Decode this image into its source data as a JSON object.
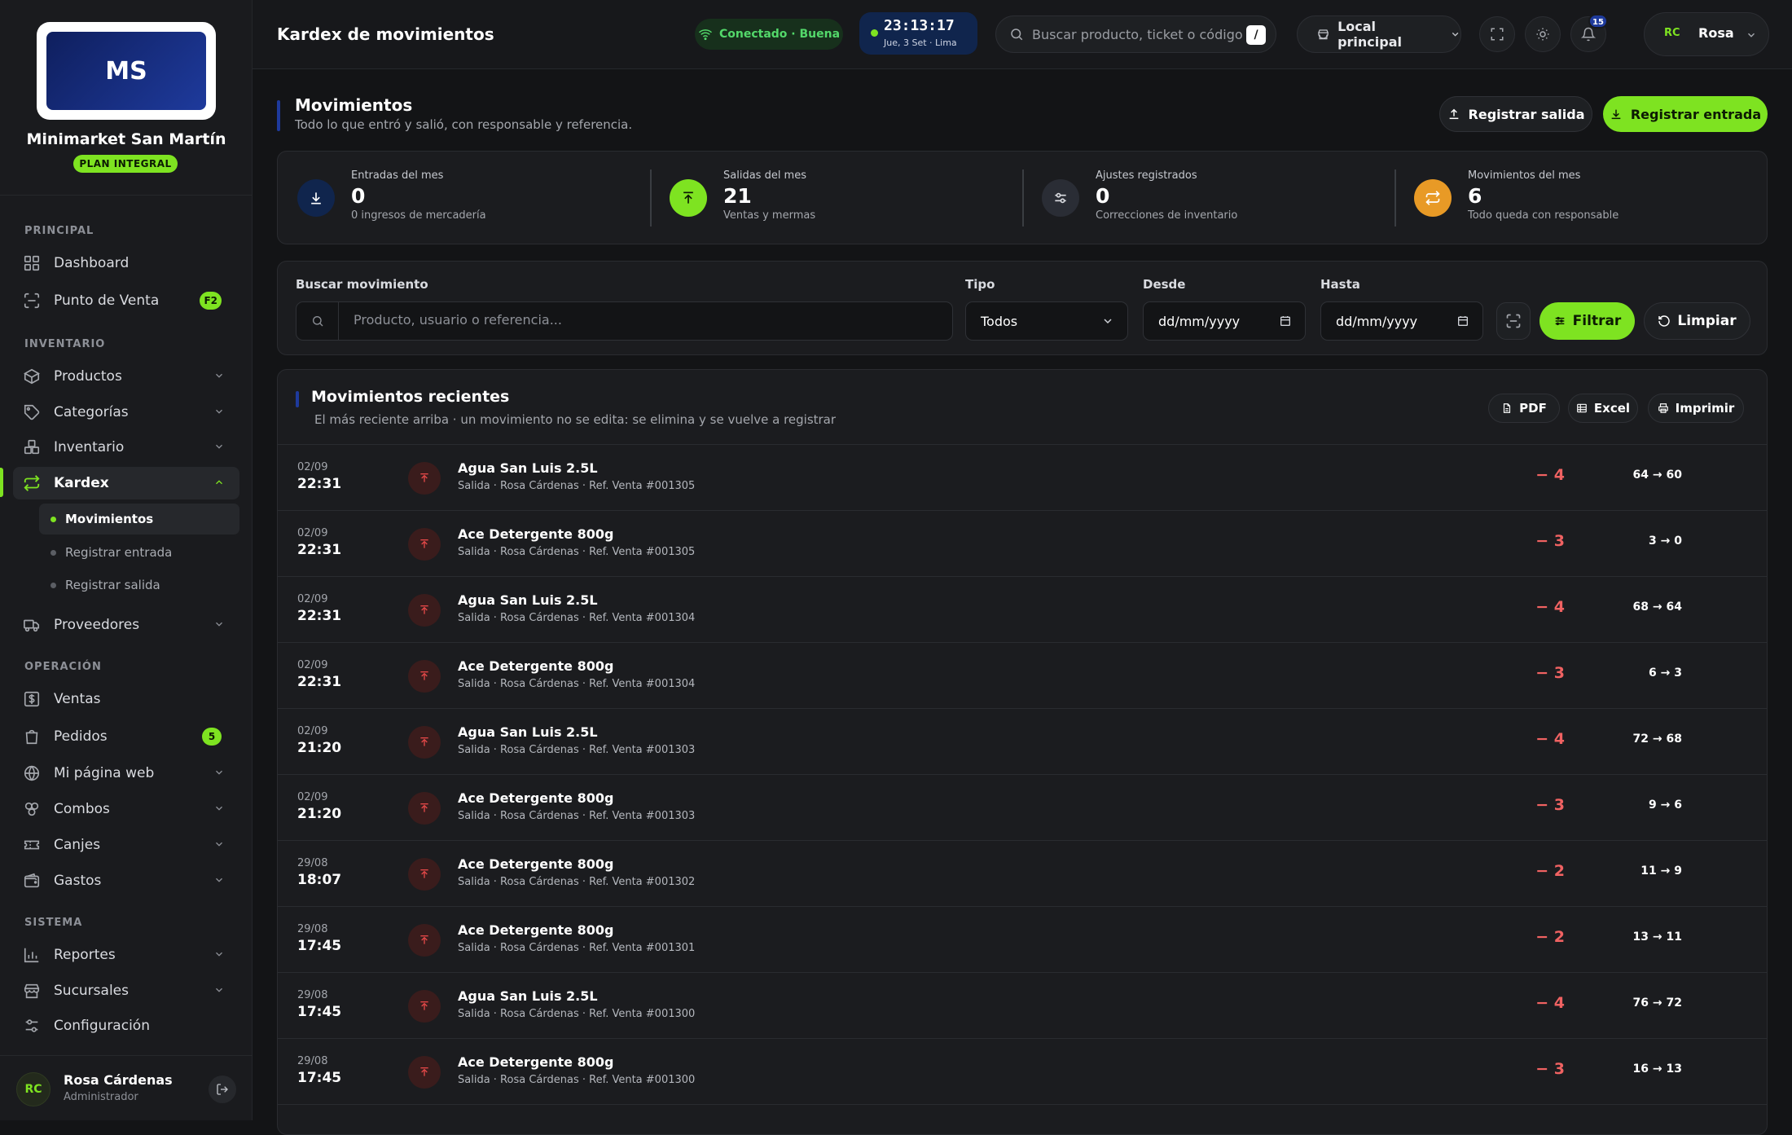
{
  "brand": {
    "logo_text": "MS",
    "name": "Minimarket San Martín",
    "plan": "PLAN INTEGRAL"
  },
  "sidebar": {
    "sections": [
      "PRINCIPAL",
      "INVENTARIO",
      "OPERACIÓN",
      "SISTEMA"
    ],
    "items": {
      "dashboard": "Dashboard",
      "pos": "Punto de Venta",
      "pos_badge": "F2",
      "productos": "Productos",
      "categorias": "Categorías",
      "inventario": "Inventario",
      "kardex": "Kardex",
      "movimientos": "Movimientos",
      "registrar_entrada": "Registrar entrada",
      "registrar_salida": "Registrar salida",
      "proveedores": "Proveedores",
      "ventas": "Ventas",
      "pedidos": "Pedidos",
      "pedidos_badge": "5",
      "web": "Mi página web",
      "combos": "Combos",
      "canjes": "Canjes",
      "gastos": "Gastos",
      "reportes": "Reportes",
      "sucursales": "Sucursales",
      "configuracion": "Configuración"
    },
    "user": {
      "initials": "RC",
      "name": "Rosa Cárdenas",
      "role": "Administrador"
    }
  },
  "topbar": {
    "title": "Kardex de movimientos",
    "connection": "Conectado · Buena",
    "time": "23:13:17",
    "date": "Jue, 3 Set · Lima",
    "search_placeholder": "Buscar producto, ticket o código...",
    "search_shortcut": "/",
    "location": "Local principal",
    "notifications": "15",
    "user_initials": "RC",
    "user_name": "Rosa"
  },
  "header": {
    "title": "Movimientos",
    "subtitle": "Todo lo que entró y salió, con responsable y referencia.",
    "btn_salida": "Registrar salida",
    "btn_entrada": "Registrar entrada"
  },
  "stats": [
    {
      "label": "Entradas del mes",
      "value": "0",
      "hint": "0 ingresos de mercadería"
    },
    {
      "label": "Salidas del mes",
      "value": "21",
      "hint": "Ventas y mermas"
    },
    {
      "label": "Ajustes registrados",
      "value": "0",
      "hint": "Correcciones de inventario"
    },
    {
      "label": "Movimientos del mes",
      "value": "6",
      "hint": "Todo queda con responsable"
    }
  ],
  "filters": {
    "search_label": "Buscar movimiento",
    "search_placeholder": "Producto, usuario o referencia...",
    "tipo_label": "Tipo",
    "tipo_value": "Todos",
    "desde_label": "Desde",
    "desde_value": "dd/mm/yyyy",
    "hasta_label": "Hasta",
    "hasta_value": "dd/mm/yyyy",
    "btn_filtrar": "Filtrar",
    "btn_limpiar": "Limpiar"
  },
  "table": {
    "title": "Movimientos recientes",
    "subtitle": "El más reciente arriba · un movimiento no se edita: se elimina y se vuelve a registrar",
    "btn_pdf": "PDF",
    "btn_excel": "Excel",
    "btn_print": "Imprimir",
    "rows": [
      {
        "date": "02/09",
        "time": "22:31",
        "product": "Agua San Luis 2.5L",
        "detail": "Salida · Rosa Cárdenas · Ref. Venta #001305",
        "qty": "− 4",
        "stock": "64 → 60"
      },
      {
        "date": "02/09",
        "time": "22:31",
        "product": "Ace Detergente 800g",
        "detail": "Salida · Rosa Cárdenas · Ref. Venta #001305",
        "qty": "− 3",
        "stock": "3 → 0"
      },
      {
        "date": "02/09",
        "time": "22:31",
        "product": "Agua San Luis 2.5L",
        "detail": "Salida · Rosa Cárdenas · Ref. Venta #001304",
        "qty": "− 4",
        "stock": "68 → 64"
      },
      {
        "date": "02/09",
        "time": "22:31",
        "product": "Ace Detergente 800g",
        "detail": "Salida · Rosa Cárdenas · Ref. Venta #001304",
        "qty": "− 3",
        "stock": "6 → 3"
      },
      {
        "date": "02/09",
        "time": "21:20",
        "product": "Agua San Luis 2.5L",
        "detail": "Salida · Rosa Cárdenas · Ref. Venta #001303",
        "qty": "− 4",
        "stock": "72 → 68"
      },
      {
        "date": "02/09",
        "time": "21:20",
        "product": "Ace Detergente 800g",
        "detail": "Salida · Rosa Cárdenas · Ref. Venta #001303",
        "qty": "− 3",
        "stock": "9 → 6"
      },
      {
        "date": "29/08",
        "time": "18:07",
        "product": "Ace Detergente 800g",
        "detail": "Salida · Rosa Cárdenas · Ref. Venta #001302",
        "qty": "− 2",
        "stock": "11 → 9"
      },
      {
        "date": "29/08",
        "time": "17:45",
        "product": "Ace Detergente 800g",
        "detail": "Salida · Rosa Cárdenas · Ref. Venta #001301",
        "qty": "− 2",
        "stock": "13 → 11"
      },
      {
        "date": "29/08",
        "time": "17:45",
        "product": "Agua San Luis 2.5L",
        "detail": "Salida · Rosa Cárdenas · Ref. Venta #001300",
        "qty": "− 4",
        "stock": "76 → 72"
      },
      {
        "date": "29/08",
        "time": "17:45",
        "product": "Ace Detergente 800g",
        "detail": "Salida · Rosa Cárdenas · Ref. Venta #001300",
        "qty": "− 3",
        "stock": "16 → 13"
      }
    ]
  },
  "colors": {
    "accent": "#7ee321",
    "brand_blue": "#1e3a9c",
    "danger": "#f06262",
    "bg": "#131416",
    "panel": "#1b1c1f"
  }
}
